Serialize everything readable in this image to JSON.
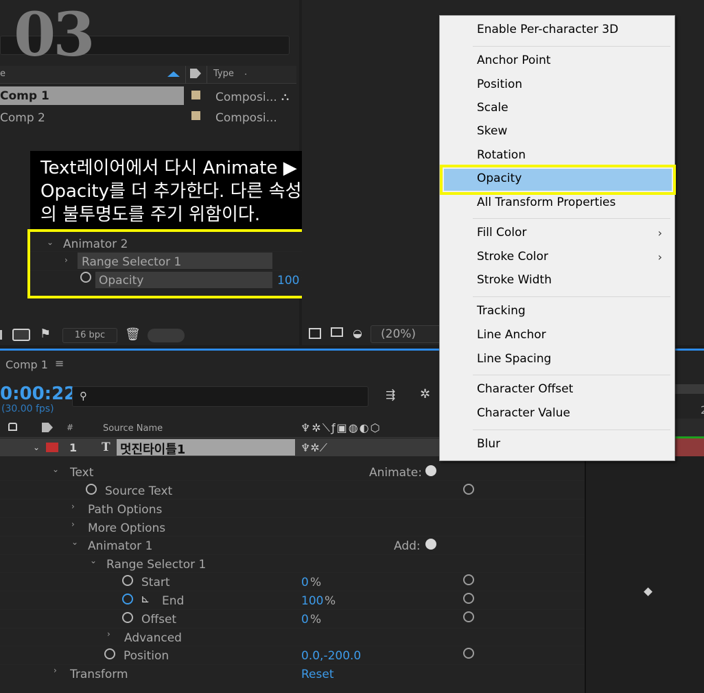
{
  "overlay_number": "03",
  "project": {
    "col_name_fragment": "e",
    "col_type": "Type",
    "items": [
      {
        "name": "Comp 1",
        "type": "Composi..."
      },
      {
        "name": "Comp 2",
        "type": "Composi..."
      }
    ],
    "bpc": "16 bpc"
  },
  "callout": {
    "lines": [
      "Text레이어에서 다시 Animate ▶",
      "Opacity를 더 추가한다. 다른 속성",
      "의 불투명도를 주기 위함이다."
    ]
  },
  "zoom_panel": {
    "animator": "Animator 2",
    "range_selector": "Range Selector 1",
    "opacity_label": "Opacity",
    "opacity_value": "100",
    "opacity_unit": "%"
  },
  "viewer": {
    "zoom": "(20%)"
  },
  "menu": {
    "items": [
      "Enable Per-character 3D",
      "Anchor Point",
      "Position",
      "Scale",
      "Skew",
      "Rotation",
      "Opacity",
      "All Transform Properties",
      "Fill Color",
      "Stroke Color",
      "Stroke Width",
      "Tracking",
      "Line Anchor",
      "Line Spacing",
      "Character Offset",
      "Character Value",
      "Blur"
    ],
    "highlighted": "Opacity",
    "highlight_color": "#99c9ef",
    "box_color": "#f7f700"
  },
  "timeline": {
    "tab": "Comp 1",
    "timecode": "0:00:22",
    "fps": "(30.00 fps)",
    "search_placeholder": "",
    "col_source": "Source Name",
    "layer_num": "1",
    "layer_type": "T",
    "layer_name": "멋진타이틀1",
    "text": "Text",
    "animate_label": "Animate:",
    "source_text": "Source Text",
    "path_options": "Path Options",
    "more_options": "More Options",
    "animator1": "Animator 1",
    "add_label": "Add:",
    "range_selector": "Range Selector 1",
    "start": "Start",
    "start_val": "0",
    "end": "End",
    "end_val": "100",
    "offset": "Offset",
    "offset_val": "0",
    "pct": "%",
    "advanced": "Advanced",
    "position": "Position",
    "position_val": "0.0,-200.0",
    "transform": "Transform",
    "reset": "Reset",
    "ruler_digit": "2"
  }
}
